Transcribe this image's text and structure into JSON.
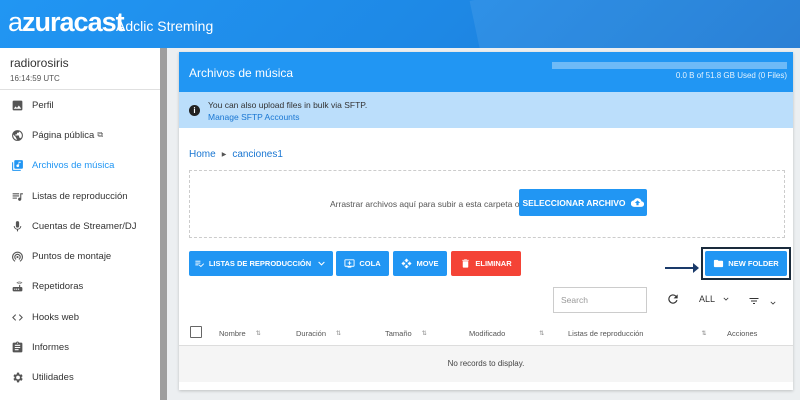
{
  "app": {
    "logo_prefix": "a",
    "logo_rest": "zuracast",
    "station_name": "Adclic Streming"
  },
  "sidebar": {
    "username": "radiorosiris",
    "time": "16:14:59 UTC",
    "items": [
      {
        "label": "Perfil",
        "icon": "image-icon"
      },
      {
        "label": "Página pública",
        "icon": "globe-icon"
      },
      {
        "label": "Archivos de música",
        "icon": "music-library-icon",
        "active": true
      },
      {
        "label": "Listas de reproducción",
        "icon": "playlist-icon"
      },
      {
        "label": "Cuentas de Streamer/DJ",
        "icon": "microphone-icon"
      },
      {
        "label": "Puntos de montaje",
        "icon": "broadcast-icon"
      },
      {
        "label": "Repetidoras",
        "icon": "router-icon"
      },
      {
        "label": "Hooks web",
        "icon": "code-icon"
      },
      {
        "label": "Informes",
        "icon": "report-icon"
      },
      {
        "label": "Utilidades",
        "icon": "gear-icon"
      }
    ]
  },
  "card": {
    "title": "Archivos de música",
    "usage": "0.0 B of 51.8 GB Used (0 Files)",
    "usage_fraction": 0.0,
    "info_text": "You can also upload files in bulk via SFTP.",
    "info_link": "Manage SFTP Accounts",
    "breadcrumb": [
      "Home",
      "canciones1"
    ],
    "drop_text": "Arrastrar archivos aquí para subir a esta carpeta o",
    "select_button": "SELECCIONAR ARCHIVO"
  },
  "toolbar": {
    "playlists": "LISTAS DE REPRODUCCIÓN",
    "queue": "COLA",
    "move": "MOVE",
    "delete": "ELIMINAR",
    "new_folder": "NEW FOLDER"
  },
  "table": {
    "search_placeholder": "Search",
    "page_size": "ALL",
    "columns": [
      "Nombre",
      "Duración",
      "Tamaño",
      "Modificado",
      "Listas de reproducción",
      "Acciones"
    ],
    "empty": "No records to display."
  },
  "colors": {
    "primary": "#2196f3",
    "danger": "#f44336",
    "info_bg": "#bbdefb"
  }
}
